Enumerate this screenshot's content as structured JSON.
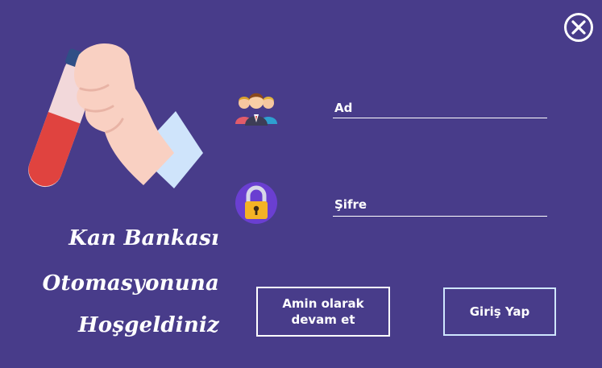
{
  "window": {
    "close_icon": "close-circle-icon"
  },
  "welcome": {
    "line1": "Kan Bankası",
    "line2": "Otomasyonuna",
    "line3": "Hoşgeldiniz"
  },
  "illustration": {
    "icon": "blood-test-tube-icon"
  },
  "login": {
    "user_icon": "users-group-icon",
    "username_placeholder": "Ad",
    "password_icon": "padlock-icon",
    "password_placeholder": "Şifre"
  },
  "buttons": {
    "admin_label": "Amin olarak devam et",
    "login_label": "Giriş Yap"
  },
  "colors": {
    "background": "#483c8a",
    "text": "#ffffff",
    "blood": "#e0433f",
    "lock_circle": "#6a3fd1",
    "lock_body": "#f4b325"
  }
}
